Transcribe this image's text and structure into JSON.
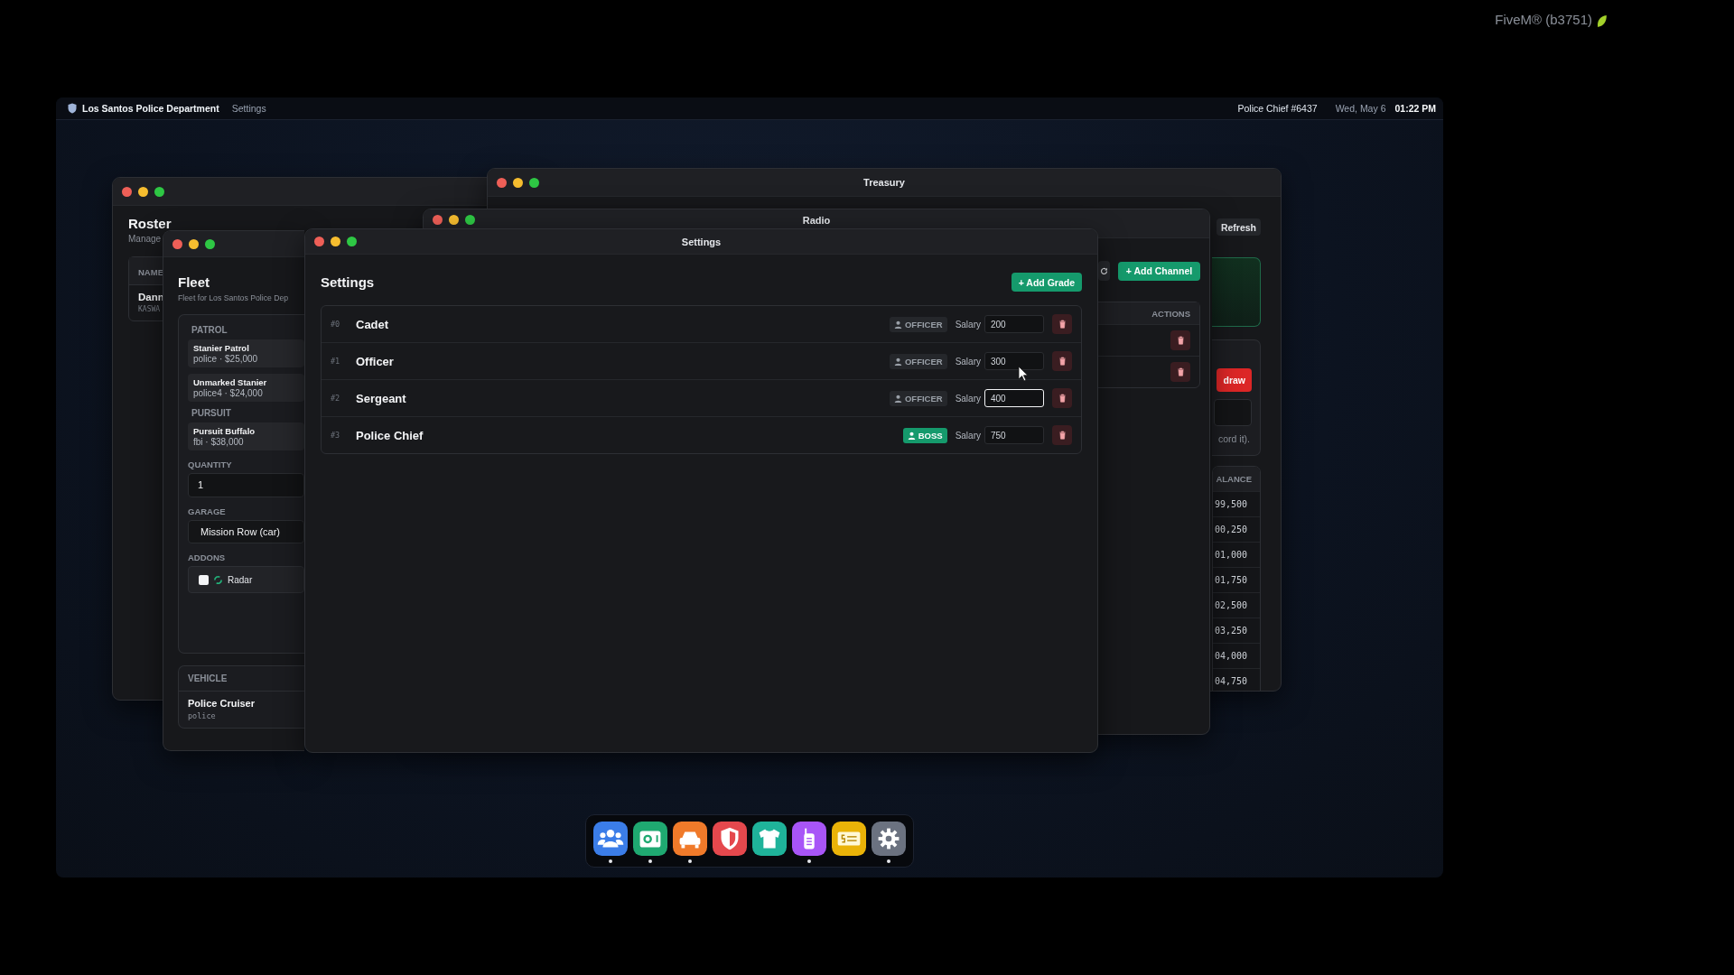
{
  "system": {
    "label": "FiveM® (b3751)"
  },
  "topbar": {
    "org": "Los Santos Police Department",
    "app": "Settings",
    "user": "Police Chief #6437",
    "date": "Wed, May 6",
    "time": "01:22 PM"
  },
  "roster": {
    "heading": "Roster",
    "subtitle": "Manage",
    "column": "NAME",
    "rows": [
      {
        "name": "Dann",
        "id": "KASWA"
      }
    ]
  },
  "treasury": {
    "title": "Treasury",
    "refresh": "Refresh",
    "withdraw": "draw",
    "note": "cord it).",
    "balance_header": "ALANCE",
    "balances": [
      "99,500",
      "00,250",
      "01,000",
      "01,750",
      "02,500",
      "03,250",
      "04,000",
      "04,750"
    ]
  },
  "radio": {
    "title": "Radio",
    "add": "+ Add Channel",
    "actions_header": "ACTIONS",
    "rows": [
      {
        "kind": "channel"
      },
      {
        "kind": "channel"
      }
    ]
  },
  "fleet": {
    "heading": "Fleet",
    "subtitle": "Fleet for Los Santos Police Dep",
    "groups": [
      {
        "label": "PATROL",
        "vehicles": [
          {
            "name": "Stanier Patrol",
            "detail": "police · $25,000"
          },
          {
            "name": "Unmarked Stanier",
            "detail": "police4 · $24,000"
          }
        ]
      },
      {
        "label": "PURSUIT",
        "vehicles": [
          {
            "name": "Pursuit Buffalo",
            "detail": "fbi · $38,000"
          }
        ]
      }
    ],
    "quantity_label": "QUANTITY",
    "quantity": "1",
    "garage_label": "GARAGE",
    "garage": "Mission Row (car)",
    "addons_label": "ADDONS",
    "addons": [
      {
        "label": "Radar",
        "checked": false
      }
    ],
    "vehicle_label": "VEHICLE",
    "vehicle": "Police Cruiser",
    "vehicle_model": "police"
  },
  "settings": {
    "title": "Settings",
    "heading": "Settings",
    "add": "+ Add Grade",
    "grades": [
      {
        "index": "#0",
        "name": "Cadet",
        "role": "OFFICER",
        "kind": "officer",
        "salary_label": "Salary",
        "salary": "200",
        "focused": false
      },
      {
        "index": "#1",
        "name": "Officer",
        "role": "OFFICER",
        "kind": "officer",
        "salary_label": "Salary",
        "salary": "300",
        "focused": false
      },
      {
        "index": "#2",
        "name": "Sergeant",
        "role": "OFFICER",
        "kind": "officer",
        "salary_label": "Salary",
        "salary": "400",
        "focused": true
      },
      {
        "index": "#3",
        "name": "Police Chief",
        "role": "BOSS",
        "kind": "boss",
        "salary_label": "Salary",
        "salary": "750",
        "focused": false
      }
    ]
  },
  "dock": [
    {
      "kind": "people",
      "color": "#3b7de8",
      "running": true
    },
    {
      "kind": "safe",
      "color": "#1fa971",
      "running": true
    },
    {
      "kind": "car",
      "color": "#f07a2a",
      "running": true
    },
    {
      "kind": "shield",
      "color": "#e5484d",
      "running": false
    },
    {
      "kind": "shirt",
      "color": "#1fb39a",
      "running": false
    },
    {
      "kind": "radio",
      "color": "#a855f7",
      "running": true
    },
    {
      "kind": "cash",
      "color": "#eab308",
      "running": false
    },
    {
      "kind": "gear",
      "color": "#6b7280",
      "running": true
    }
  ]
}
